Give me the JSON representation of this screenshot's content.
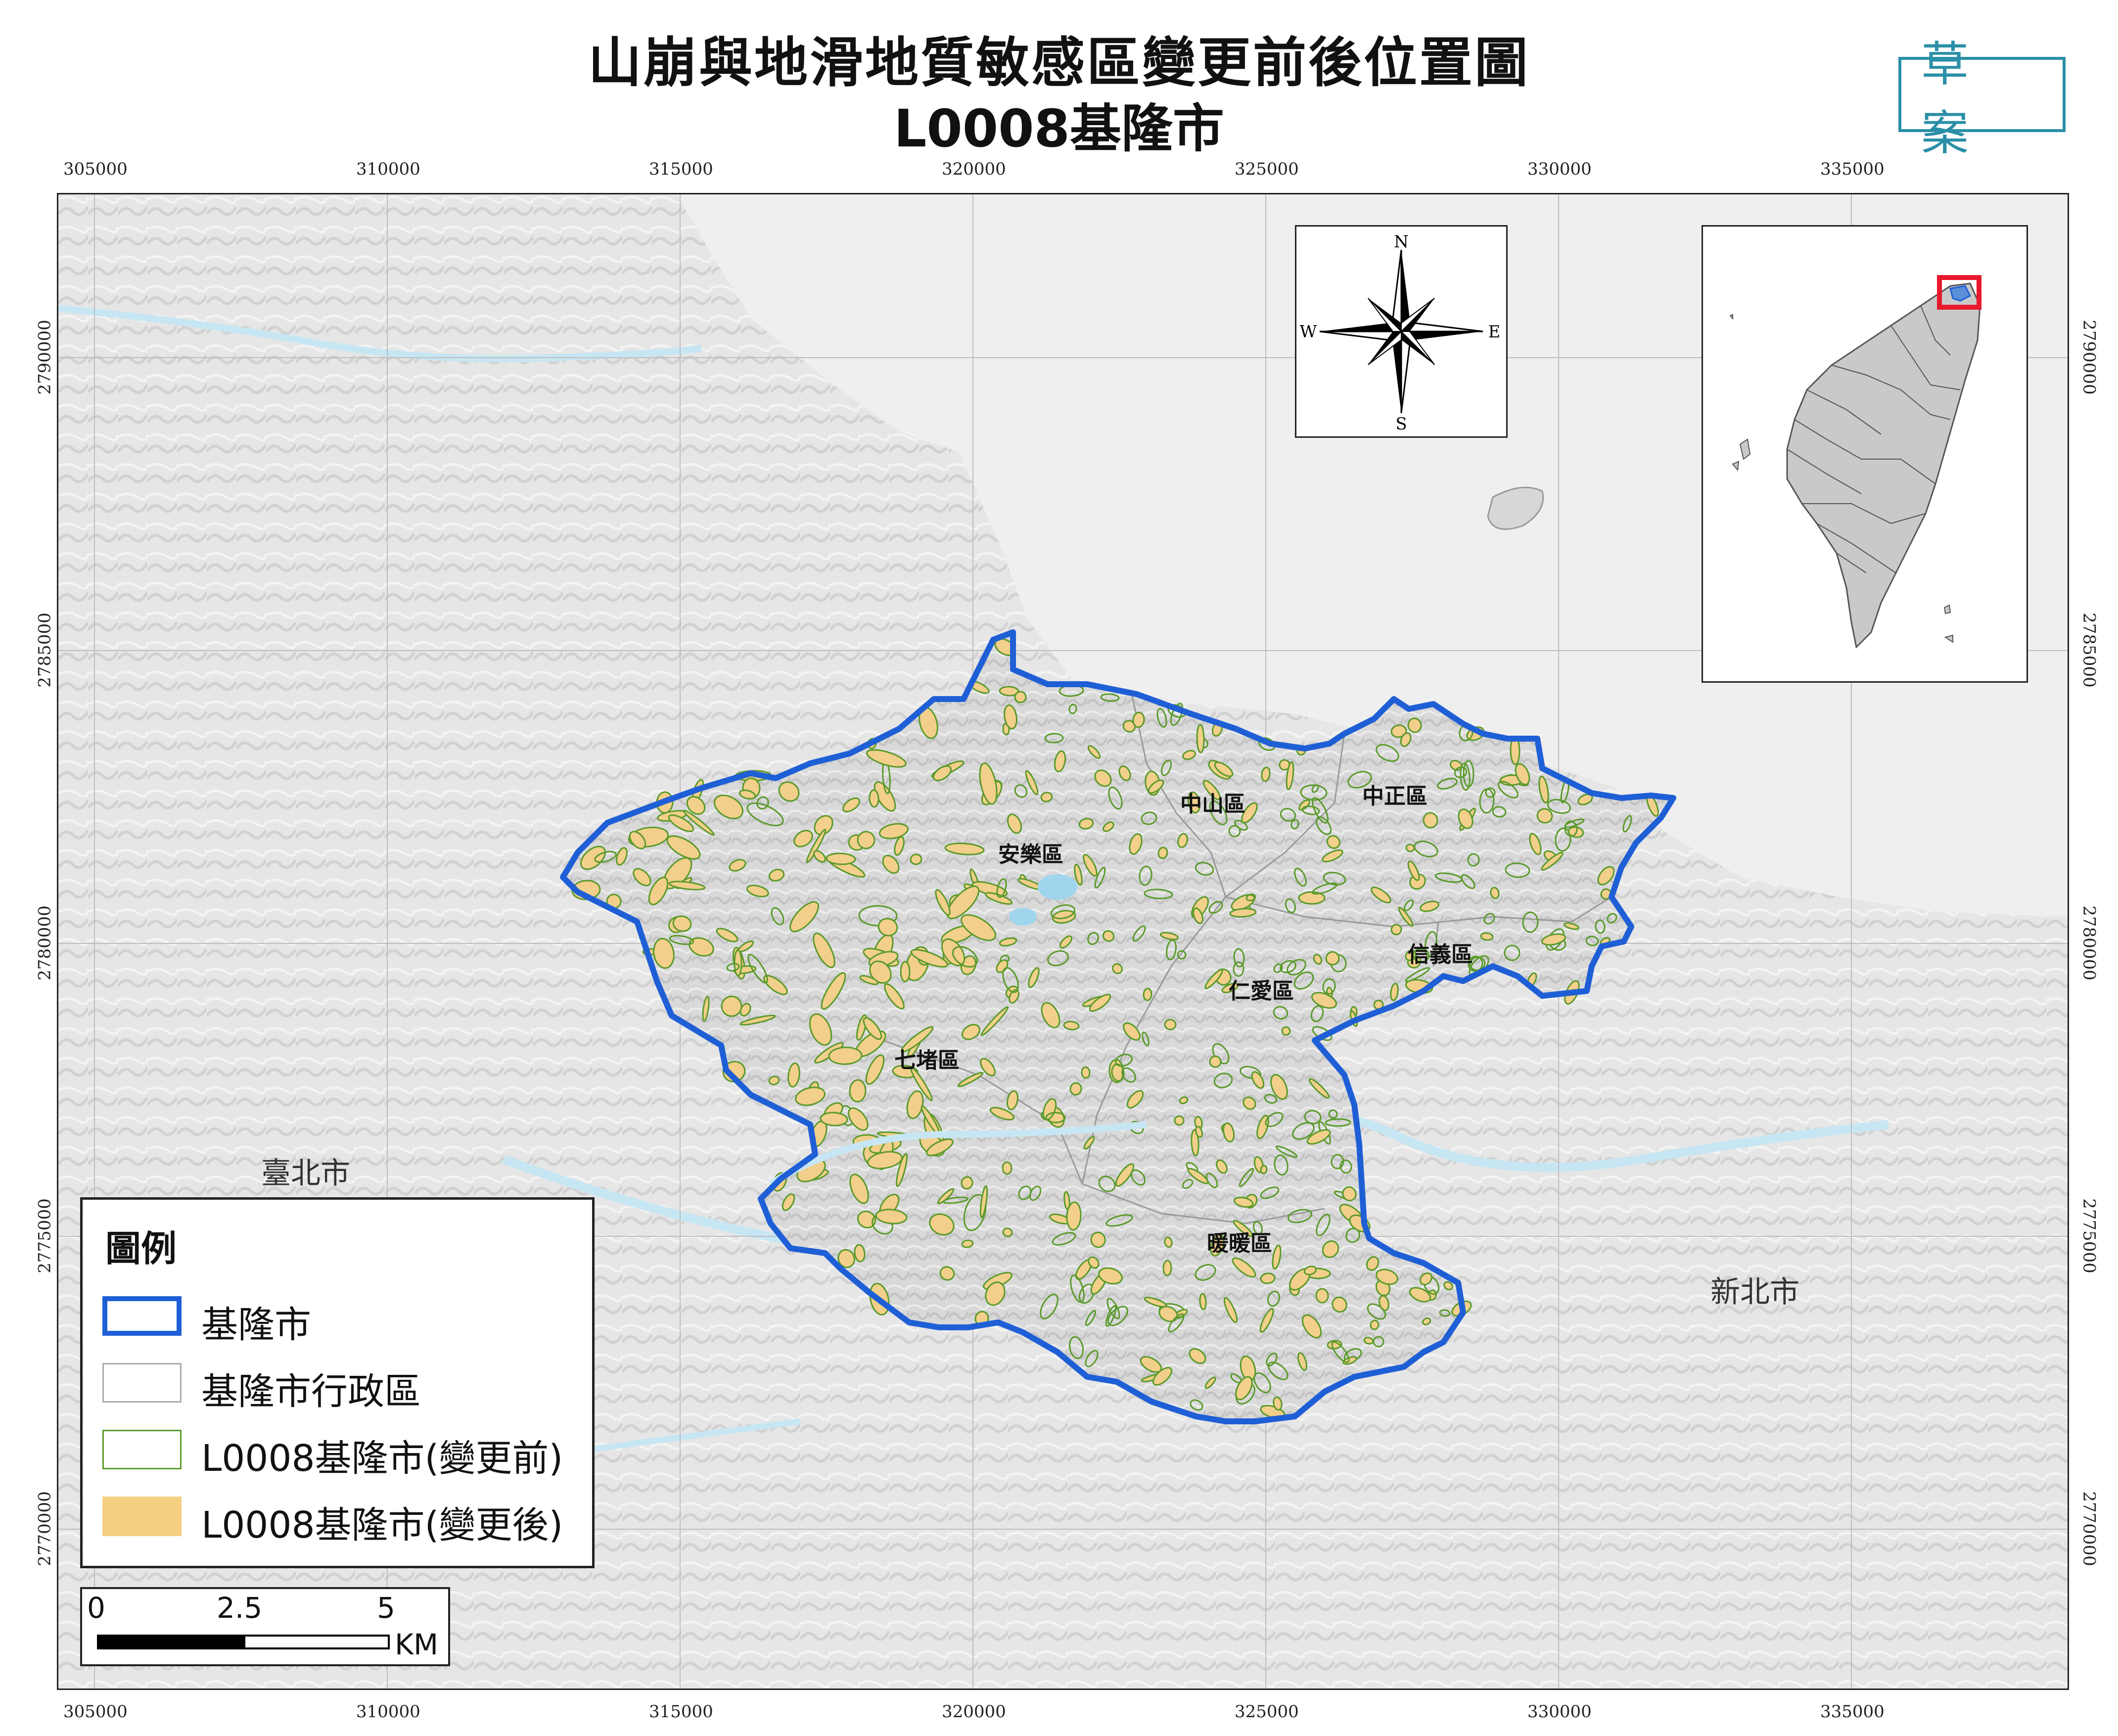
{
  "title_line1": "山崩與地滑地質敏感區變更前後位置圖",
  "title_line2": "L0008基隆市",
  "draft_stamp": "草 案",
  "x_ticks": [
    "305000",
    "310000",
    "315000",
    "320000",
    "325000",
    "330000",
    "335000"
  ],
  "y_ticks": [
    "2790000",
    "2785000",
    "2780000",
    "2775000",
    "2770000"
  ],
  "district_labels": [
    "中山區",
    "中正區",
    "安樂區",
    "信義區",
    "仁愛區",
    "七堵區",
    "暖暖區"
  ],
  "city_labels": [
    "臺北市",
    "新北市"
  ],
  "compass": {
    "n": "N",
    "s": "S",
    "e": "E",
    "w": "W"
  },
  "legend": {
    "title": "圖例",
    "items": [
      {
        "label": "基隆市",
        "color": "#1f5fd6"
      },
      {
        "label": "基隆市行政區",
        "color": "#aaaaaa"
      },
      {
        "label": "L0008基隆市(變更前)",
        "color": "#5a9a2a"
      },
      {
        "label": "L0008基隆市(變更後)",
        "color": "#f5cf80"
      }
    ]
  },
  "scale": {
    "labels": [
      "0",
      "2.5",
      "5"
    ],
    "unit": "KM"
  },
  "colors": {
    "boundary": "#1f5fd6",
    "sea": "#efefef",
    "land": "#e2e2e2",
    "river": "#bfe3f1",
    "before_outline": "#5a9a2a",
    "after_fill": "#f2cf8a",
    "inset_highlight": "#e8192c"
  }
}
